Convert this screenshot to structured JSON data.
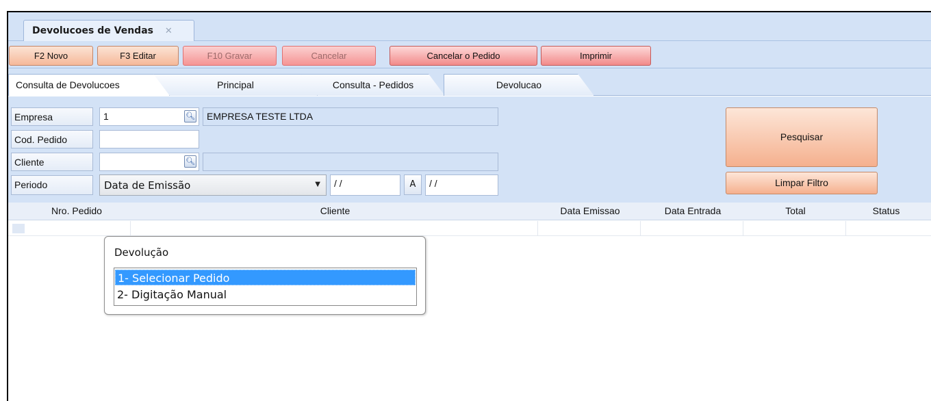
{
  "document_tab": {
    "title": "Devolucoes de Vendas",
    "close": "✕"
  },
  "toolbar": {
    "buttons": [
      {
        "label": "F2 Novo"
      },
      {
        "label": "F3 Editar"
      },
      {
        "label": "F10 Gravar"
      },
      {
        "label": "Cancelar"
      },
      {
        "label": "Cancelar o Pedido"
      },
      {
        "label": "Imprimir"
      }
    ]
  },
  "tabs": [
    {
      "label": "Consulta de Devolucoes"
    },
    {
      "label": "Principal"
    },
    {
      "label": "Consulta - Pedidos"
    },
    {
      "label": "Devolucao"
    }
  ],
  "filters": {
    "empresa": {
      "label": "Empresa",
      "code": "1",
      "name": "EMPRESA TESTE LTDA"
    },
    "cod_pedido": {
      "label": "Cod. Pedido",
      "value": ""
    },
    "cliente": {
      "label": "Cliente",
      "code": "",
      "name": ""
    },
    "periodo": {
      "label": "Periodo",
      "selected": "Data de Emissão",
      "from": "/ /",
      "to_label": "A",
      "to": "/ /"
    },
    "search_button": "Pesquisar",
    "clear_button": "Limpar Filtro"
  },
  "grid": {
    "columns": [
      "Nro. Pedido",
      "Cliente",
      "Data Emissao",
      "Data Entrada",
      "Total",
      "Status"
    ]
  },
  "popup": {
    "title": "Devolução",
    "options": [
      "1- Selecionar Pedido",
      "2- Digitação Manual"
    ],
    "selected_index": 0
  }
}
